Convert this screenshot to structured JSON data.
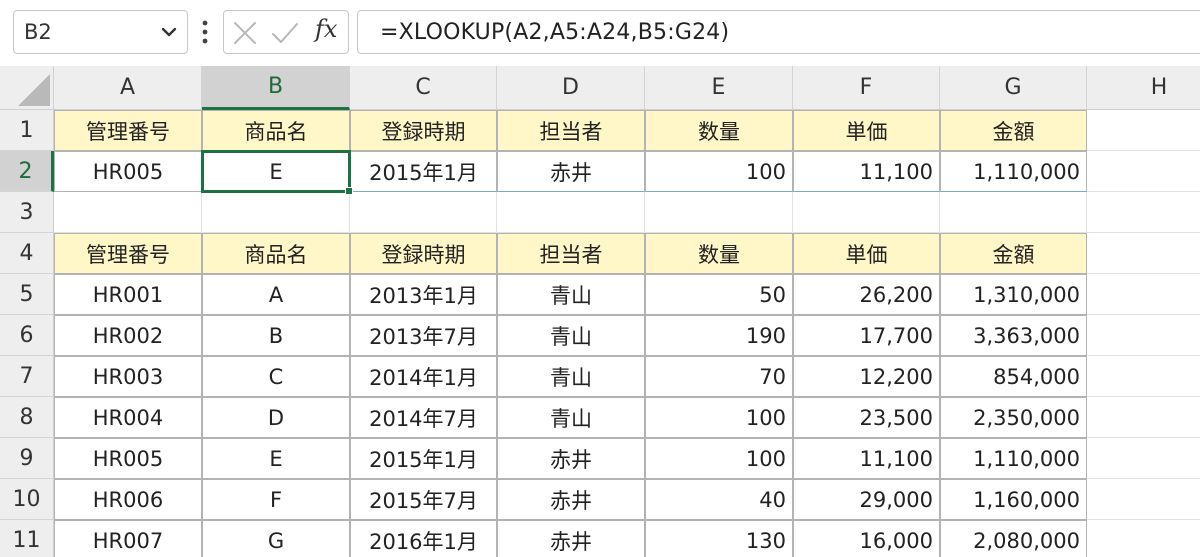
{
  "formula_bar": {
    "namebox": "B2",
    "formula": "=XLOOKUP(A2,A5:A24,B5:G24)",
    "fx_label": "fx",
    "icons": {
      "cancel": "cross-icon",
      "enter": "check-icon",
      "more": "vertical-dots-icon",
      "dropdown": "chevron-down-icon"
    }
  },
  "colors": {
    "header_fill": "#fff7c8",
    "selection": "#1e7145"
  },
  "sheet": {
    "columns": [
      "A",
      "B",
      "C",
      "D",
      "E",
      "F",
      "G",
      "H"
    ],
    "rows": [
      "1",
      "2",
      "3",
      "4",
      "5",
      "6",
      "7",
      "8",
      "9",
      "10",
      "11"
    ],
    "active_cell": "B2",
    "lookup": {
      "headers": [
        "管理番号",
        "商品名",
        "登録時期",
        "担当者",
        "数量",
        "単価",
        "金額"
      ],
      "result": [
        "HR005",
        "E",
        "2015年1月",
        "赤井",
        "100",
        "11,100",
        "1,110,000"
      ]
    },
    "table": {
      "headers": [
        "管理番号",
        "商品名",
        "登録時期",
        "担当者",
        "数量",
        "単価",
        "金額"
      ],
      "rows": [
        [
          "HR001",
          "A",
          "2013年1月",
          "青山",
          "50",
          "26,200",
          "1,310,000"
        ],
        [
          "HR002",
          "B",
          "2013年7月",
          "青山",
          "190",
          "17,700",
          "3,363,000"
        ],
        [
          "HR003",
          "C",
          "2014年1月",
          "青山",
          "70",
          "12,200",
          "854,000"
        ],
        [
          "HR004",
          "D",
          "2014年7月",
          "青山",
          "100",
          "23,500",
          "2,350,000"
        ],
        [
          "HR005",
          "E",
          "2015年1月",
          "赤井",
          "100",
          "11,100",
          "1,110,000"
        ],
        [
          "HR006",
          "F",
          "2015年7月",
          "赤井",
          "40",
          "29,000",
          "1,160,000"
        ],
        [
          "HR007",
          "G",
          "2016年1月",
          "赤井",
          "130",
          "16,000",
          "2,080,000"
        ]
      ]
    }
  }
}
